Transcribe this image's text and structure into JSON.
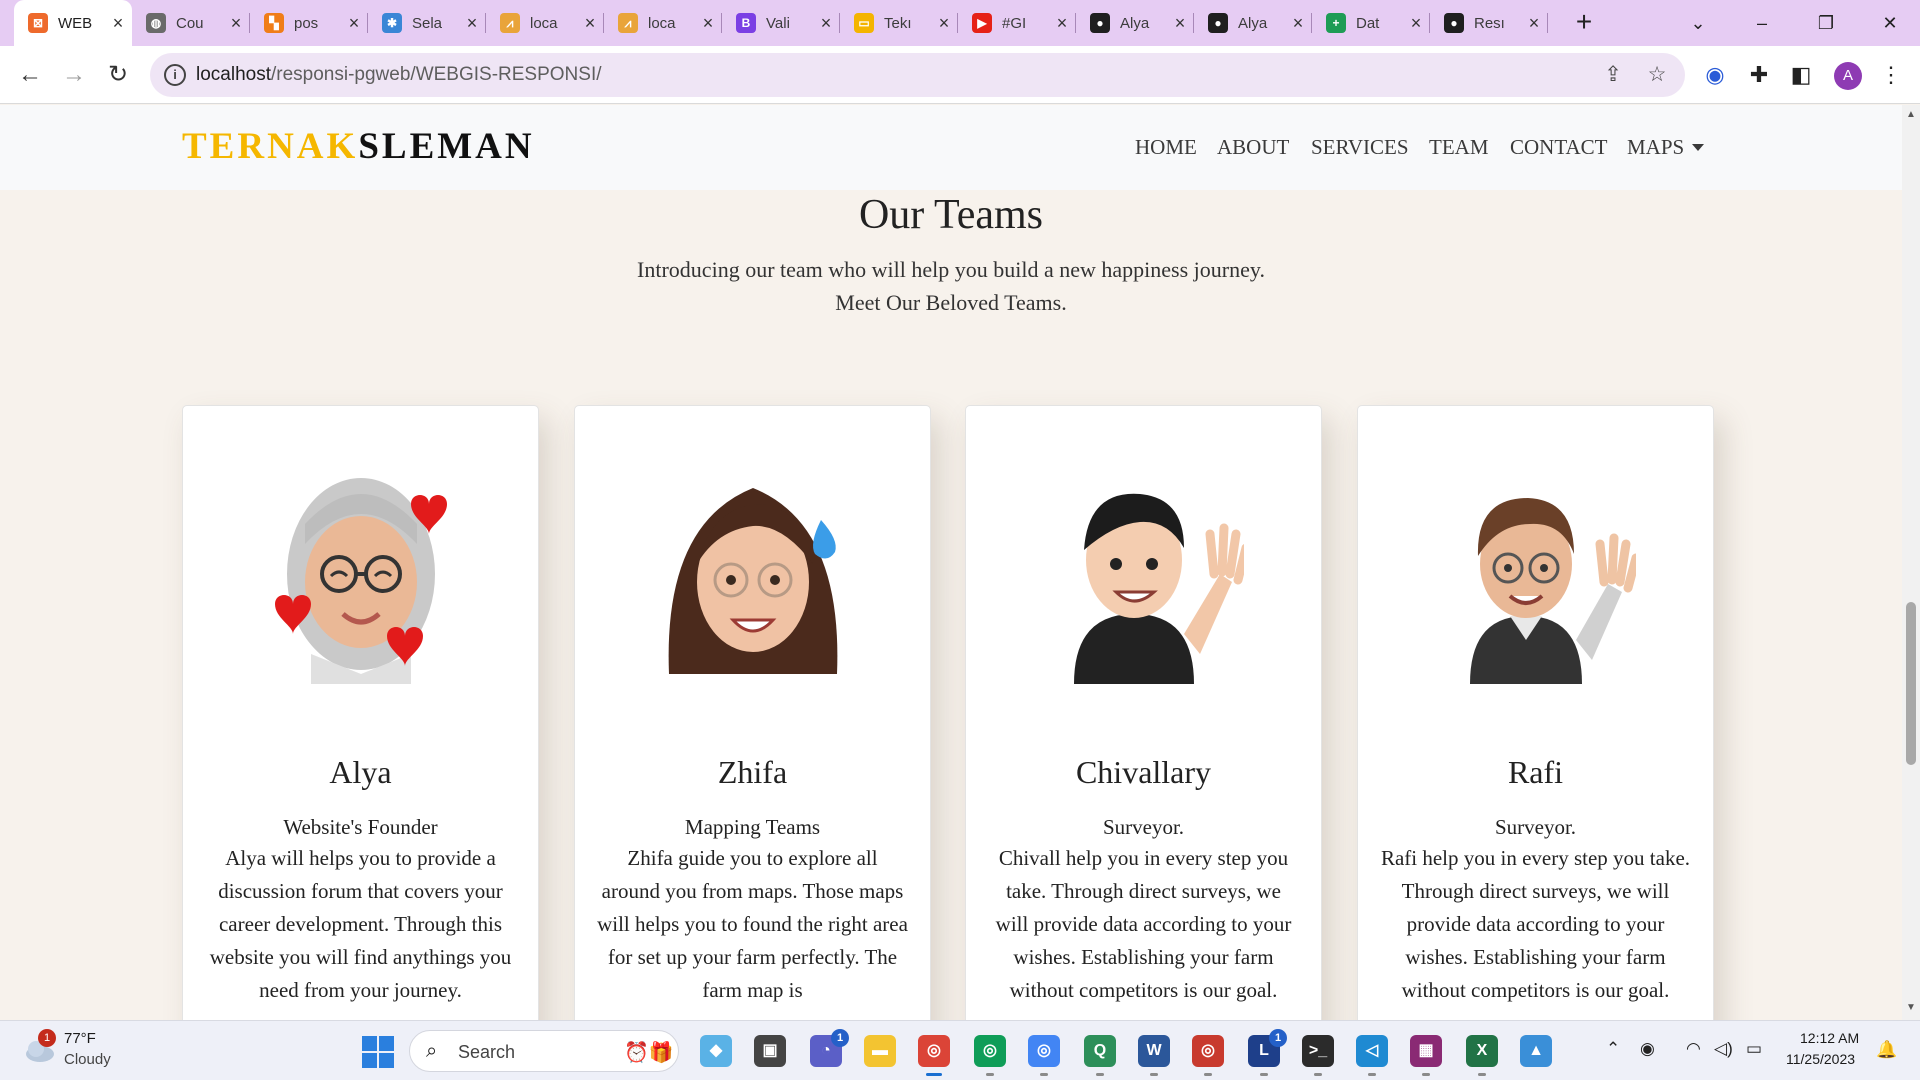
{
  "browser": {
    "tabs": [
      {
        "title": "WEB",
        "favicon_color": "#ee6a2c",
        "favicon_glyph": "⊠"
      },
      {
        "title": "Cou",
        "favicon_color": "#6a6a6a",
        "favicon_glyph": "◍"
      },
      {
        "title": "pos",
        "favicon_color": "#f07d18",
        "favicon_glyph": "▚"
      },
      {
        "title": "Sela",
        "favicon_color": "#3a86d6",
        "favicon_glyph": "✱"
      },
      {
        "title": "loca",
        "favicon_color": "#e9a43a",
        "favicon_glyph": "⩘"
      },
      {
        "title": "loca",
        "favicon_color": "#e9a43a",
        "favicon_glyph": "⩘"
      },
      {
        "title": "Vali",
        "favicon_color": "#7b3fe4",
        "favicon_glyph": "B"
      },
      {
        "title": "Tekı",
        "favicon_color": "#f4b400",
        "favicon_glyph": "▭"
      },
      {
        "title": "#GI",
        "favicon_color": "#e62117",
        "favicon_glyph": "▶"
      },
      {
        "title": "Alya",
        "favicon_color": "#1f1f1f",
        "favicon_glyph": "●"
      },
      {
        "title": "Alya",
        "favicon_color": "#1f1f1f",
        "favicon_glyph": "●"
      },
      {
        "title": "Dat",
        "favicon_color": "#1e9c55",
        "favicon_glyph": "+"
      },
      {
        "title": "Resı",
        "favicon_color": "#1f1f1f",
        "favicon_glyph": "●"
      }
    ],
    "url_host": "localhost",
    "url_path": "/responsi-pgweb/WEBGIS-RESPONSI/",
    "profile_initial": "A"
  },
  "site": {
    "brand_part1": "TERNAK",
    "brand_part2": "SLEMAN",
    "nav": {
      "home": "HOME",
      "about": "ABOUT",
      "services": "SERVICES",
      "team": "TEAM",
      "contact": "CONTACT",
      "maps": "MAPS"
    },
    "heading": "Our Teams",
    "subtitle_line1": "Introducing our team who will help you build a new happiness journey.",
    "subtitle_line2": "Meet Our Beloved Teams."
  },
  "team": [
    {
      "name": "Alya",
      "role": "Website's Founder",
      "description": "Alya will helps you to provide a discussion forum that covers your career development. Through this website you will find anythings you need from your journey."
    },
    {
      "name": "Zhifa",
      "role": "Mapping Teams",
      "description": "Zhifa guide you to explore all around you from maps. Those maps will helps you to found the right area for set up your farm perfectly. The farm map is"
    },
    {
      "name": "Chivallary",
      "role": "Surveyor.",
      "description": "Chivall help you in every step you take. Through direct surveys, we will provide data according to your wishes. Establishing your farm without competitors is our goal."
    },
    {
      "name": "Rafi",
      "role": "Surveyor.",
      "description": "Rafi help you in every step you take. Through direct surveys, we will provide data according to your wishes. Establishing your farm without competitors is our goal."
    }
  ],
  "taskbar": {
    "weather_alert_count": "1",
    "temperature": "77°F",
    "condition": "Cloudy",
    "search_label": "Search",
    "teams_badge": "1",
    "l_badge": "1",
    "time": "12:12 AM",
    "date": "11/25/2023"
  }
}
